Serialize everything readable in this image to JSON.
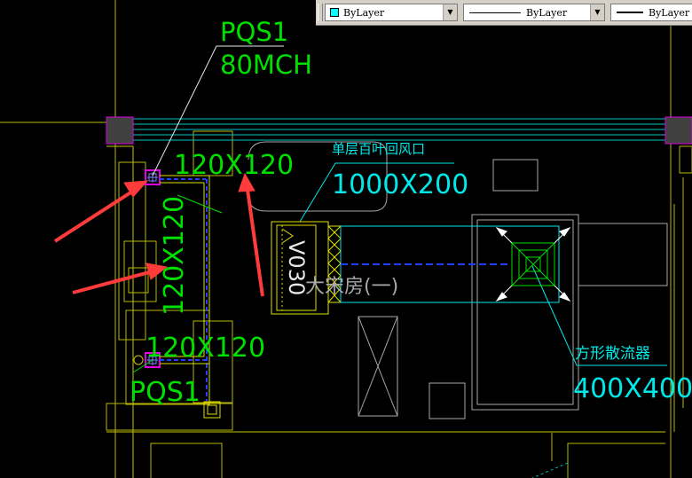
{
  "toolbar": {
    "color_value": "ByLayer",
    "color_swatch": "#00ffff",
    "linetype_value": "ByLayer",
    "lineweight_value": "ByLayer",
    "dropdown_icon": "chevron-down-icon"
  },
  "drawing": {
    "top_tag_name": "PQS1",
    "top_tag_flow": "80MCH",
    "duct_size_top": "120X120",
    "duct_size_vertical": "120X120",
    "duct_size_bottom": "120X120",
    "bottom_tag_name": "PQS1",
    "grille_label": "单层百叶回风口",
    "grille_size": "1000X200",
    "unit_code": "V030",
    "room_name": "大宋房(一)",
    "diffuser_label": "方形散流器",
    "diffuser_size": "400X400",
    "colors": {
      "green": "#00e000",
      "cyan": "#00e8e8",
      "yellow": "#e0e000",
      "magenta": "#e000e0",
      "blue": "#2040ff",
      "arrow": "#ff3b3b",
      "background": "#000000"
    }
  }
}
